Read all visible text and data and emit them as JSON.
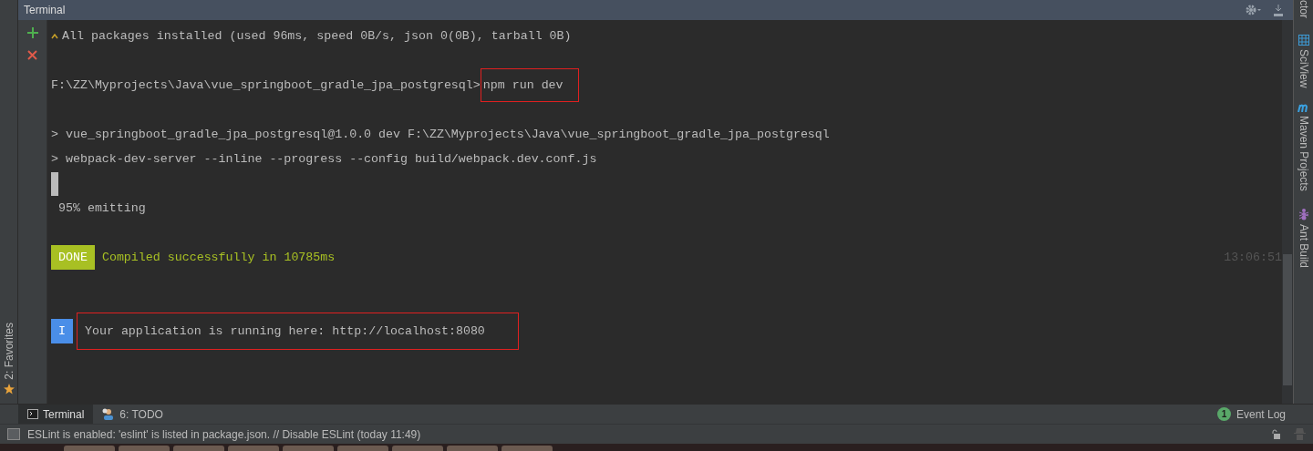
{
  "tool_window": {
    "title": "Terminal"
  },
  "left_strip": {
    "label": "2: Favorites"
  },
  "terminal_lines": [
    {
      "kind": "info",
      "text": "All packages installed (used 96ms, speed 0B/s, json 0(0B), tarball 0B)"
    },
    {
      "kind": "blank"
    },
    {
      "kind": "command",
      "prompt": "F:\\ZZ\\Myprojects\\Java\\vue_springboot_gradle_jpa_postgresql>",
      "command": "npm run dev",
      "highlighted": true
    },
    {
      "kind": "blank"
    },
    {
      "kind": "text",
      "text": "> vue_springboot_gradle_jpa_postgresql@1.0.0 dev F:\\ZZ\\Myprojects\\Java\\vue_springboot_gradle_jpa_postgresql"
    },
    {
      "kind": "text",
      "text": "> webpack-dev-server --inline --progress --config build/webpack.dev.conf.js"
    },
    {
      "kind": "cursor"
    },
    {
      "kind": "text",
      "text": " 95% emitting"
    },
    {
      "kind": "blank"
    },
    {
      "kind": "badge",
      "badge": "DONE",
      "color": "#a8c023",
      "message": "Compiled successfully in 10785ms",
      "time": "13:06:51",
      "highlighted": false
    },
    {
      "kind": "blank"
    },
    {
      "kind": "blank"
    },
    {
      "kind": "badge",
      "badge": "I",
      "color": "#4a8ee8",
      "message": "Your application is running here: http://localhost:8080",
      "highlighted": true
    }
  ],
  "right_sidebar": [
    {
      "label": "ctor",
      "kind": "plain"
    },
    {
      "label": "SciView",
      "kind": "grid"
    },
    {
      "label": "Maven Projects",
      "kind": "maven"
    },
    {
      "label": "Ant Build",
      "kind": "ant"
    }
  ],
  "bottom_tabs": [
    {
      "label": "Terminal",
      "selected": true,
      "kind": "terminal"
    },
    {
      "label": "6: TODO",
      "selected": false,
      "kind": "todo"
    }
  ],
  "event_log": {
    "count": "1",
    "label": "Event Log"
  },
  "status_bar": {
    "message": "ESLint is enabled: 'eslint' is listed in package.json. // Disable ESLint (today 11:49)"
  }
}
